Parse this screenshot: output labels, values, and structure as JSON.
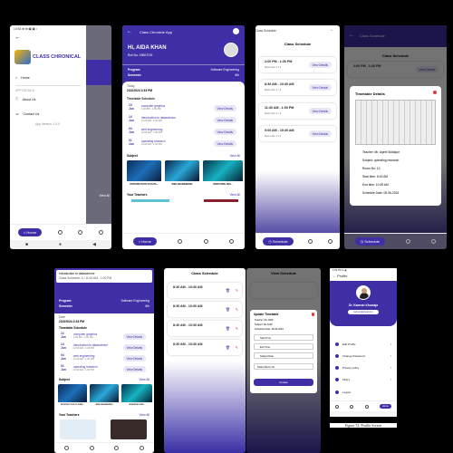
{
  "s1": {
    "status": "10:54 ⊕ ⊕ ▣ ▣ •",
    "logo_text": "CLASS CHRONICAL",
    "menu_home": "Home",
    "section_label": "APP DETAILS",
    "menu_about": "About Us",
    "menu_contact": "Contact Us",
    "version": "App Version: 1.0.0",
    "bg_peek": "View All",
    "home_btn": "Home"
  },
  "s2": {
    "app_title": "Class Chronicle App",
    "greeting": "Hi, AIDA KHAN",
    "roll": "Roll No: 19BEIT26",
    "program_label": "Program",
    "program_value": "Software Engineering",
    "semester_label": "Semester",
    "semester_value": "8th",
    "today_label": "Today",
    "today_value": "2/22/2024 2:33 PM",
    "timetable_heading": "Timetable Schedule",
    "courses": [
      {
        "date": "13",
        "mon": "Jun",
        "name": "computer graphics",
        "time": "1:00 PM - 1:00 PM"
      },
      {
        "date": "14",
        "mon": "Jun",
        "name": "introduction to datascience",
        "time": "11:00 AM - 1:00 PM"
      },
      {
        "date": "04",
        "mon": "Jun",
        "name": "web engineering",
        "time": "11:00 AM - 1:00 PM"
      },
      {
        "date": "01",
        "mon": "Jun",
        "name": "operating research",
        "time": "11:00 AM - 1:00 PM"
      }
    ],
    "view_details": "View Details",
    "subject_heading": "Subject",
    "view_all": "View All",
    "subjects": [
      "INTRODUCTION TO DATA...",
      "WEB ENGINEERING",
      "OPERATING RES..."
    ],
    "teachers_heading": "Your Teachers",
    "home_btn": "Home"
  },
  "s3": {
    "title_peek": "Class Schedule",
    "heading": "Class Schedule",
    "slots": [
      {
        "time": "2:00 PM - 1:30 PM",
        "sub": "Room No 1 / 4"
      },
      {
        "time": "8:30 AM - 10:30 AM",
        "sub": "Room No 1 / 4"
      },
      {
        "time": "11:30 AM - 1:00 PM",
        "sub": "Room No 1 / 4"
      },
      {
        "time": "9:00 AM - 10:30 AM",
        "sub": "Room No 1 / 4"
      }
    ],
    "view_details": "View Details",
    "nav_btn": "Schedule"
  },
  "s4": {
    "title": "Class Schedule",
    "heading": "Class Schedule",
    "slot_time": "2:00 PM - 1:30 PM",
    "view_details": "View Details",
    "dialog_title": "Timetable Details",
    "details": [
      "Teacher: Mr. Aqeel Siddique",
      "Subject: operating research",
      "Room No: 13",
      "Start time: 8:15 AM",
      "End time: 10:45 AM",
      "Schedule Date: 05-06-2024"
    ],
    "nav_btn": "Schedule"
  },
  "s5": {
    "peek1": "Introduction to datascience",
    "peek2": "Class Schedule: 4 / 11:00 AM - 1:00 PM",
    "program_label": "Program",
    "program_value": "Software Engineering",
    "semester_label": "Semester",
    "semester_value": "8th",
    "today_label": "Date",
    "today_value": "2/22/2024 2:33 PM",
    "timetable_heading": "Timetable Schedule",
    "view_details": "View Details",
    "subject_heading": "Subject",
    "view_all": "View All",
    "subjects": [
      "INTRODUCTION TO DATA...",
      "WEB ENGINEERING",
      "OPERATING RES..."
    ],
    "teachers_heading": "Your Teachers"
  },
  "s6": {
    "heading": "Class Schedule",
    "slots": [
      "8:30 AM - 10:30 AM",
      "8:30 AM - 10:30 AM",
      "8:30 AM - 10:30 AM",
      "8:30 AM - 10:30 AM"
    ]
  },
  "s7": {
    "heading": "View Schedule",
    "dialog_title": "Update Timetable",
    "dlg_info": [
      "Teacher: Rs 1000",
      "Subject: Rs 1000",
      "Schedule Date: 18-06-2024"
    ],
    "fields": [
      "Start Time",
      "End Time",
      "Subject Date",
      "Select Room No"
    ],
    "update_btn": "Update"
  },
  "s8": {
    "status": "6:09 PM ⊕ ▣",
    "title": "Profile",
    "name": "Dr. Kamran Khowaja",
    "email": "kamran@gmail.com",
    "menu": [
      "Edit Profile",
      "Change Password",
      "Privacy policy",
      "FAQ's"
    ],
    "logout": "Logout",
    "home_btn": "Home"
  },
  "caption": "Figure 72: Profile Screen"
}
